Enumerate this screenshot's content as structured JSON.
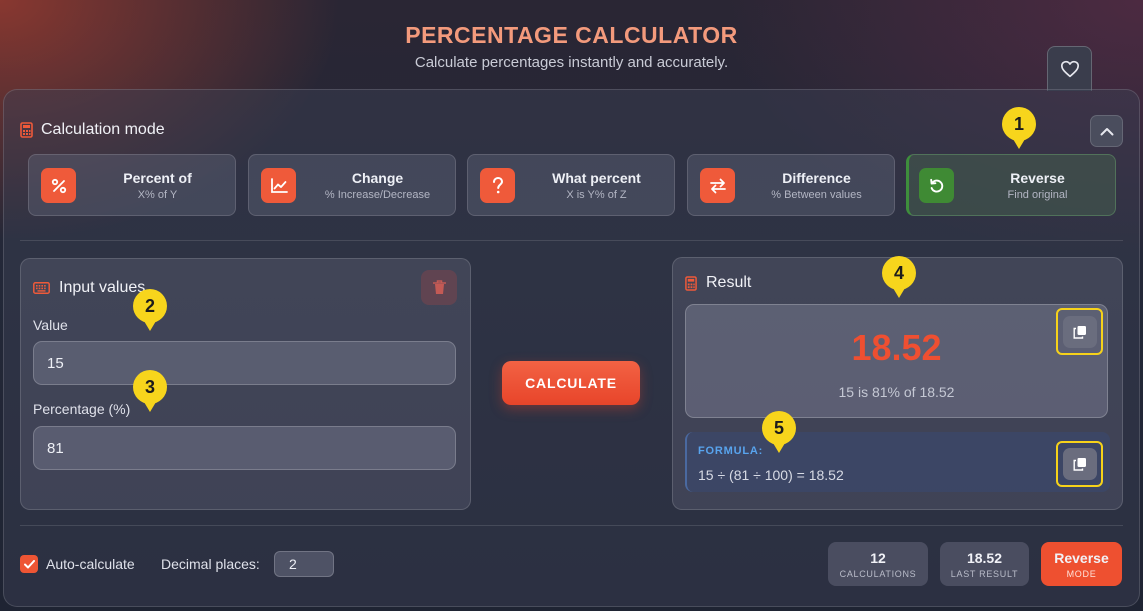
{
  "header": {
    "title": "PERCENTAGE CALCULATOR",
    "subtitle": "Calculate percentages instantly and accurately."
  },
  "mode_section": {
    "title": "Calculation mode",
    "modes": [
      {
        "name": "Percent of",
        "desc": "X% of Y",
        "icon": "percent-icon"
      },
      {
        "name": "Change",
        "desc": "% Increase/Decrease",
        "icon": "chart-line-icon"
      },
      {
        "name": "What percent",
        "desc": "X is Y% of Z",
        "icon": "question-icon"
      },
      {
        "name": "Difference",
        "desc": "% Between values",
        "icon": "swap-icon"
      },
      {
        "name": "Reverse",
        "desc": "Find original",
        "icon": "undo-icon",
        "active": true
      }
    ]
  },
  "input_panel": {
    "title": "Input values",
    "value_label": "Value",
    "value": "15",
    "percentage_label": "Percentage (%)",
    "percentage": "81"
  },
  "calculate_label": "CALCULATE",
  "result_panel": {
    "title": "Result",
    "value": "18.52",
    "description": "15 is 81% of 18.52",
    "formula_label": "FORMULA:",
    "formula": "15 ÷ (81 ÷ 100) = 18.52"
  },
  "markers": [
    "1",
    "2",
    "3",
    "4",
    "5"
  ],
  "footer": {
    "auto_calculate_label": "Auto-calculate",
    "auto_calculate_checked": true,
    "decimal_label": "Decimal places:",
    "decimal_value": "2",
    "stats": [
      {
        "value": "12",
        "label": "CALCULATIONS"
      },
      {
        "value": "18.52",
        "label": "LAST RESULT"
      },
      {
        "value": "Reverse",
        "label": "MODE"
      }
    ]
  },
  "colors": {
    "accent": "#ef5a3a",
    "active_mode": "#3f8a34",
    "highlight": "#f6d21a",
    "formula_label": "#58a4ee"
  }
}
